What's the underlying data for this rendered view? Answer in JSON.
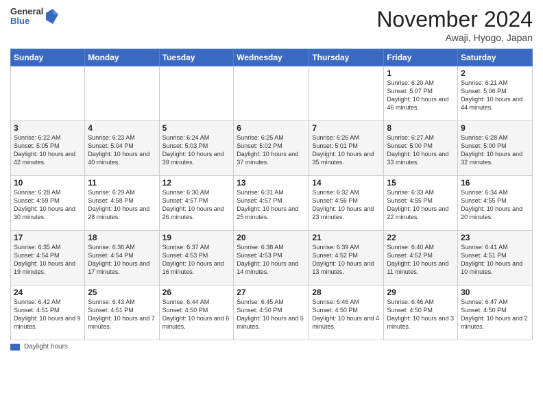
{
  "header": {
    "logo": {
      "general": "General",
      "blue": "Blue"
    },
    "title": "November 2024",
    "location": "Awaji, Hyogo, Japan"
  },
  "weekdays": [
    "Sunday",
    "Monday",
    "Tuesday",
    "Wednesday",
    "Thursday",
    "Friday",
    "Saturday"
  ],
  "weeks": [
    [
      null,
      null,
      null,
      null,
      null,
      {
        "day": "1",
        "sunrise": "Sunrise: 6:20 AM",
        "sunset": "Sunset: 5:07 PM",
        "daylight": "Daylight: 10 hours and 46 minutes."
      },
      {
        "day": "2",
        "sunrise": "Sunrise: 6:21 AM",
        "sunset": "Sunset: 5:06 PM",
        "daylight": "Daylight: 10 hours and 44 minutes."
      }
    ],
    [
      {
        "day": "3",
        "sunrise": "Sunrise: 6:22 AM",
        "sunset": "Sunset: 5:05 PM",
        "daylight": "Daylight: 10 hours and 42 minutes."
      },
      {
        "day": "4",
        "sunrise": "Sunrise: 6:23 AM",
        "sunset": "Sunset: 5:04 PM",
        "daylight": "Daylight: 10 hours and 40 minutes."
      },
      {
        "day": "5",
        "sunrise": "Sunrise: 6:24 AM",
        "sunset": "Sunset: 5:03 PM",
        "daylight": "Daylight: 10 hours and 39 minutes."
      },
      {
        "day": "6",
        "sunrise": "Sunrise: 6:25 AM",
        "sunset": "Sunset: 5:02 PM",
        "daylight": "Daylight: 10 hours and 37 minutes."
      },
      {
        "day": "7",
        "sunrise": "Sunrise: 6:26 AM",
        "sunset": "Sunset: 5:01 PM",
        "daylight": "Daylight: 10 hours and 35 minutes."
      },
      {
        "day": "8",
        "sunrise": "Sunrise: 6:27 AM",
        "sunset": "Sunset: 5:00 PM",
        "daylight": "Daylight: 10 hours and 33 minutes."
      },
      {
        "day": "9",
        "sunrise": "Sunrise: 6:28 AM",
        "sunset": "Sunset: 5:00 PM",
        "daylight": "Daylight: 10 hours and 32 minutes."
      }
    ],
    [
      {
        "day": "10",
        "sunrise": "Sunrise: 6:28 AM",
        "sunset": "Sunset: 4:59 PM",
        "daylight": "Daylight: 10 hours and 30 minutes."
      },
      {
        "day": "11",
        "sunrise": "Sunrise: 6:29 AM",
        "sunset": "Sunset: 4:58 PM",
        "daylight": "Daylight: 10 hours and 28 minutes."
      },
      {
        "day": "12",
        "sunrise": "Sunrise: 6:30 AM",
        "sunset": "Sunset: 4:57 PM",
        "daylight": "Daylight: 10 hours and 26 minutes."
      },
      {
        "day": "13",
        "sunrise": "Sunrise: 6:31 AM",
        "sunset": "Sunset: 4:57 PM",
        "daylight": "Daylight: 10 hours and 25 minutes."
      },
      {
        "day": "14",
        "sunrise": "Sunrise: 6:32 AM",
        "sunset": "Sunset: 4:56 PM",
        "daylight": "Daylight: 10 hours and 23 minutes."
      },
      {
        "day": "15",
        "sunrise": "Sunrise: 6:33 AM",
        "sunset": "Sunset: 4:55 PM",
        "daylight": "Daylight: 10 hours and 22 minutes."
      },
      {
        "day": "16",
        "sunrise": "Sunrise: 6:34 AM",
        "sunset": "Sunset: 4:55 PM",
        "daylight": "Daylight: 10 hours and 20 minutes."
      }
    ],
    [
      {
        "day": "17",
        "sunrise": "Sunrise: 6:35 AM",
        "sunset": "Sunset: 4:54 PM",
        "daylight": "Daylight: 10 hours and 19 minutes."
      },
      {
        "day": "18",
        "sunrise": "Sunrise: 6:36 AM",
        "sunset": "Sunset: 4:54 PM",
        "daylight": "Daylight: 10 hours and 17 minutes."
      },
      {
        "day": "19",
        "sunrise": "Sunrise: 6:37 AM",
        "sunset": "Sunset: 4:53 PM",
        "daylight": "Daylight: 10 hours and 16 minutes."
      },
      {
        "day": "20",
        "sunrise": "Sunrise: 6:38 AM",
        "sunset": "Sunset: 4:53 PM",
        "daylight": "Daylight: 10 hours and 14 minutes."
      },
      {
        "day": "21",
        "sunrise": "Sunrise: 6:39 AM",
        "sunset": "Sunset: 4:52 PM",
        "daylight": "Daylight: 10 hours and 13 minutes."
      },
      {
        "day": "22",
        "sunrise": "Sunrise: 6:40 AM",
        "sunset": "Sunset: 4:52 PM",
        "daylight": "Daylight: 10 hours and 11 minutes."
      },
      {
        "day": "23",
        "sunrise": "Sunrise: 6:41 AM",
        "sunset": "Sunset: 4:51 PM",
        "daylight": "Daylight: 10 hours and 10 minutes."
      }
    ],
    [
      {
        "day": "24",
        "sunrise": "Sunrise: 6:42 AM",
        "sunset": "Sunset: 4:51 PM",
        "daylight": "Daylight: 10 hours and 9 minutes."
      },
      {
        "day": "25",
        "sunrise": "Sunrise: 6:43 AM",
        "sunset": "Sunset: 4:51 PM",
        "daylight": "Daylight: 10 hours and 7 minutes."
      },
      {
        "day": "26",
        "sunrise": "Sunrise: 6:44 AM",
        "sunset": "Sunset: 4:50 PM",
        "daylight": "Daylight: 10 hours and 6 minutes."
      },
      {
        "day": "27",
        "sunrise": "Sunrise: 6:45 AM",
        "sunset": "Sunset: 4:50 PM",
        "daylight": "Daylight: 10 hours and 5 minutes."
      },
      {
        "day": "28",
        "sunrise": "Sunrise: 6:46 AM",
        "sunset": "Sunset: 4:50 PM",
        "daylight": "Daylight: 10 hours and 4 minutes."
      },
      {
        "day": "29",
        "sunrise": "Sunrise: 6:46 AM",
        "sunset": "Sunset: 4:50 PM",
        "daylight": "Daylight: 10 hours and 3 minutes."
      },
      {
        "day": "30",
        "sunrise": "Sunrise: 6:47 AM",
        "sunset": "Sunset: 4:50 PM",
        "daylight": "Daylight: 10 hours and 2 minutes."
      }
    ]
  ],
  "footer": {
    "legend_label": "Daylight hours"
  }
}
